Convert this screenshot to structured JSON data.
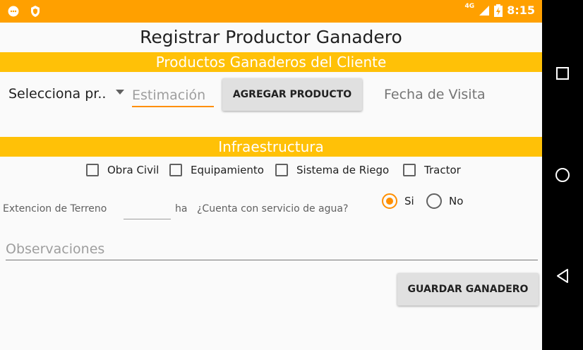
{
  "status": {
    "network": "4G",
    "time": "8:15"
  },
  "title": "Registrar Productor Ganadero",
  "section_productos": "Productos Ganaderos del Cliente",
  "producto_select": {
    "value": "Selecciona pr.."
  },
  "estimacion": {
    "placeholder": "Estimación"
  },
  "agregar_button": "AGREGAR PRODUCTO",
  "fecha_label": "Fecha de Visita",
  "section_infra": "Infraestructura",
  "checkboxes": [
    {
      "label": "Obra Civil",
      "checked": false
    },
    {
      "label": "Equipamiento",
      "checked": false
    },
    {
      "label": "Sistema de Riego",
      "checked": false
    },
    {
      "label": "Tractor",
      "checked": false
    }
  ],
  "terreno": {
    "label": "Extencion de Terreno",
    "unit": "ha"
  },
  "agua": {
    "question": "¿Cuenta con servicio de agua?",
    "options": [
      "Si",
      "No"
    ],
    "selected": "Si"
  },
  "observaciones": {
    "placeholder": "Observaciones"
  },
  "guardar_button": "GUARDAR GANADERO",
  "colors": {
    "status_bar": "#ffa000",
    "band": "#ffc107",
    "accent": "#ff8f00"
  }
}
